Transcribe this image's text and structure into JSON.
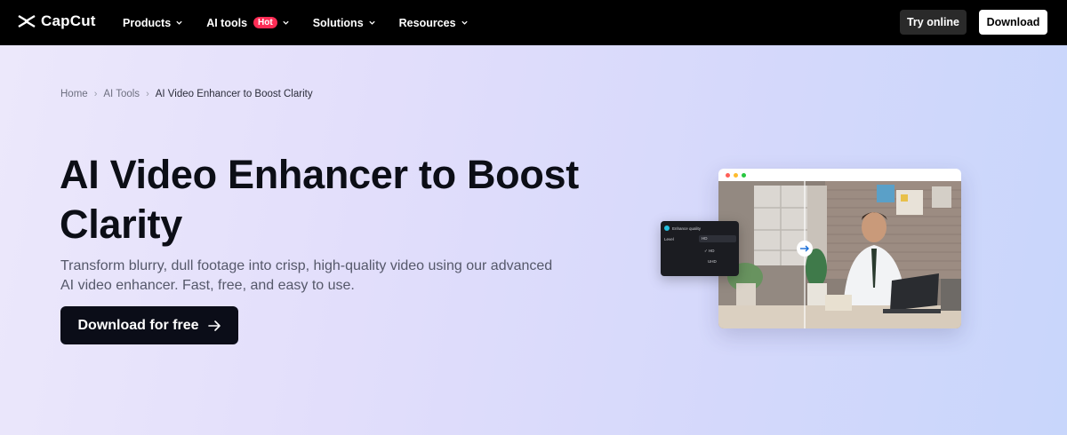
{
  "nav": {
    "logo": "CapCut",
    "items": [
      {
        "label": "Products"
      },
      {
        "label": "AI tools",
        "badge": "Hot"
      },
      {
        "label": "Solutions"
      },
      {
        "label": "Resources"
      }
    ],
    "try_online": "Try online",
    "download": "Download"
  },
  "breadcrumb": {
    "home": "Home",
    "tools": "AI Tools",
    "current": "AI Video Enhancer to Boost Clarity"
  },
  "hero": {
    "title": "AI Video Enhancer to Boost Clarity",
    "subtitle": "Transform blurry, dull footage into crisp, high-quality video using our advanced AI video enhancer. Fast, free, and easy to use.",
    "cta": "Download for free"
  },
  "panel": {
    "heading": "Enhance quality",
    "level_label": "Level",
    "selected": "HD",
    "options": [
      "HD",
      "UHD"
    ]
  },
  "colors": {
    "nav_bg": "#000000",
    "accent_hot": "#fe2c55",
    "cta_bg": "#0b0d18",
    "toggle": "#26c0e0"
  },
  "icons": [
    "capcut-logo-icon",
    "chevron-down-icon",
    "arrow-right-icon",
    "compare-arrow-icon",
    "check-icon"
  ]
}
